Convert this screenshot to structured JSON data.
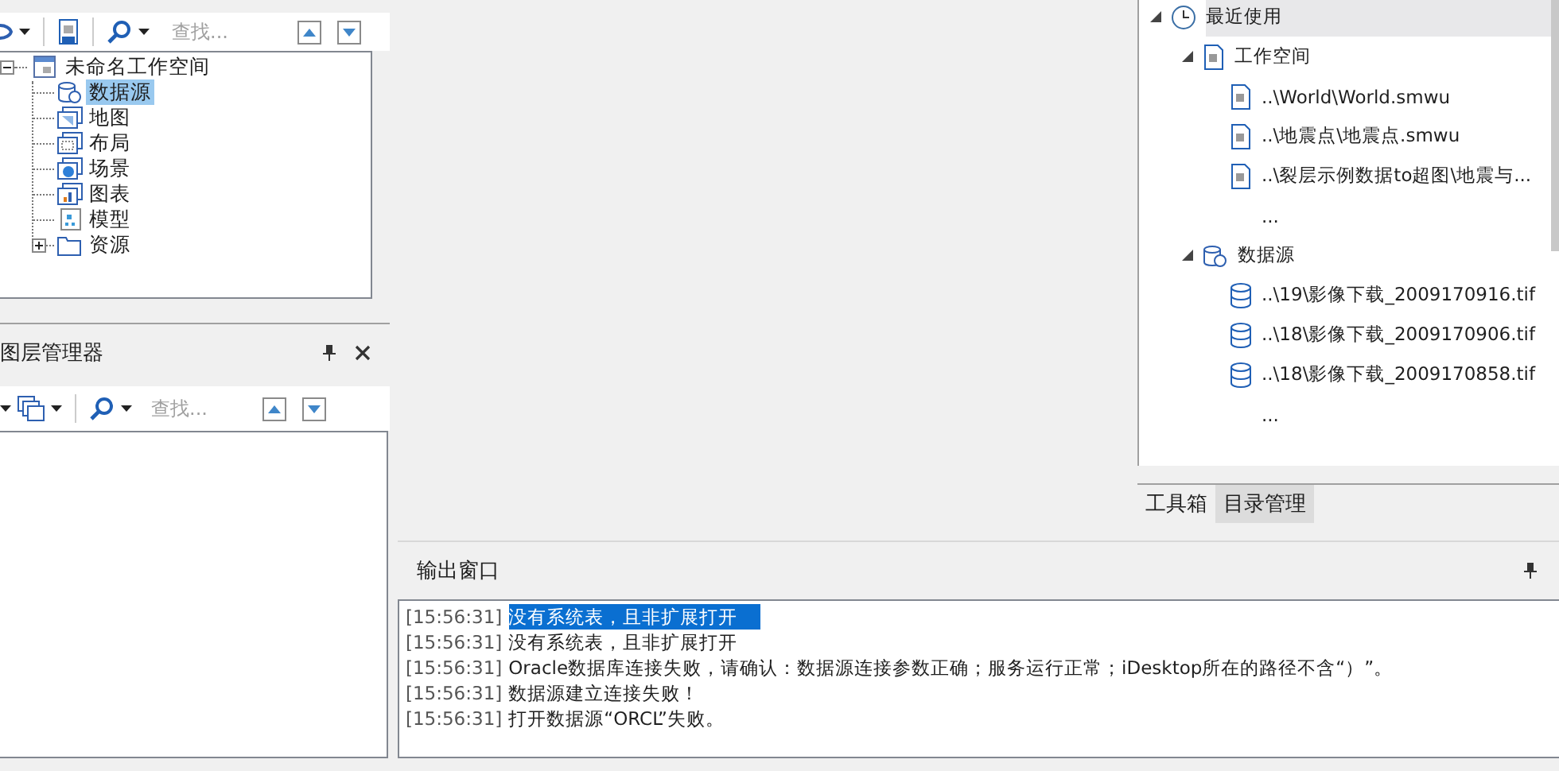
{
  "workspace": {
    "search_placeholder": "查找...",
    "tree": {
      "label": "未命名工作空间",
      "expanded": true,
      "children": [
        {
          "label": "数据源",
          "kind": "datasource",
          "selected": true
        },
        {
          "label": "地图",
          "kind": "map",
          "selected": false
        },
        {
          "label": "布局",
          "kind": "layout",
          "selected": false
        },
        {
          "label": "场景",
          "kind": "scene",
          "selected": false
        },
        {
          "label": "图表",
          "kind": "chart",
          "selected": false
        },
        {
          "label": "模型",
          "kind": "model",
          "selected": false
        },
        {
          "label": "资源",
          "kind": "resource",
          "selected": false,
          "expanded": false
        }
      ]
    }
  },
  "layer_manager": {
    "title": "图层管理器",
    "search_placeholder": "查找..."
  },
  "catalog": {
    "title": "最近使用",
    "expanded": true,
    "groups": [
      {
        "label": "工作空间",
        "kind": "workspace",
        "expanded": true,
        "items": [
          "..\\World\\World.smwu",
          "..\\地震点\\地震点.smwu",
          "..\\裂层示例数据to超图\\地震与..."
        ],
        "more": "..."
      },
      {
        "label": "数据源",
        "kind": "datasource",
        "expanded": true,
        "items": [
          "..\\19\\影像下载_2009170916.tif",
          "..\\18\\影像下载_2009170906.tif",
          "..\\18\\影像下载_2009170858.tif"
        ],
        "more": "..."
      }
    ]
  },
  "tabs": [
    {
      "label": "工具箱",
      "selected": false
    },
    {
      "label": "目录管理",
      "selected": true
    }
  ],
  "output": {
    "title": "输出窗口",
    "lines": [
      {
        "time": "[15:56:31]",
        "message": "没有系统表，且非扩展打开",
        "selected": true
      },
      {
        "time": "[15:56:31]",
        "message": "没有系统表，且非扩展打开",
        "selected": false
      },
      {
        "time": "[15:56:31]",
        "message": "Oracle数据库连接失败，请确认：数据源连接参数正确；服务运行正常；iDesktop所在的路径不含“）”。",
        "selected": false
      },
      {
        "time": "[15:56:31]",
        "message": "数据源建立连接失败！",
        "selected": false
      },
      {
        "time": "[15:56:31]",
        "message": "打开数据源“ORCL”失败。",
        "selected": false
      }
    ]
  }
}
